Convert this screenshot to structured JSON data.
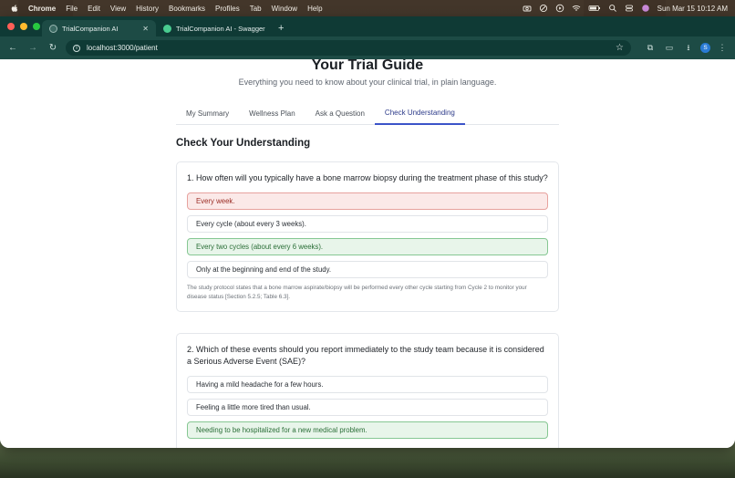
{
  "menubar": {
    "app": "Chrome",
    "menus": [
      "File",
      "Edit",
      "View",
      "History",
      "Bookmarks",
      "Profiles",
      "Tab",
      "Window",
      "Help"
    ],
    "clock": "Sun Mar 15  10:12 AM"
  },
  "browser": {
    "tabs": [
      {
        "title": "TrialCompanion AI",
        "active": true
      },
      {
        "title": "TrialCompanion AI - Swagger",
        "active": false
      }
    ],
    "url": "localhost:3000/patient",
    "profile_initial": "S"
  },
  "page": {
    "title": "Your Trial Guide",
    "subtitle": "Everything you need to know about your clinical trial, in plain language.",
    "tabs": [
      {
        "label": "My Summary",
        "active": false
      },
      {
        "label": "Wellness Plan",
        "active": false
      },
      {
        "label": "Ask a Question",
        "active": false
      },
      {
        "label": "Check Understanding",
        "active": true
      }
    ],
    "section_title": "Check Your Understanding",
    "questions": [
      {
        "text": "1. How often will you typically have a bone marrow biopsy during the treatment phase of this study?",
        "options": [
          {
            "label": "Every week.",
            "state": "wrong"
          },
          {
            "label": "Every cycle (about every 3 weeks).",
            "state": "neutral"
          },
          {
            "label": "Every two cycles (about every 6 weeks).",
            "state": "correct"
          },
          {
            "label": "Only at the beginning and end of the study.",
            "state": "neutral"
          }
        ],
        "explanation": "The study protocol states that a bone marrow aspirate/biopsy will be performed every other cycle starting from Cycle 2 to monitor your disease status [Section 5.2.5; Table 6.3]."
      },
      {
        "text": "2. Which of these events should you report immediately to the study team because it is considered a Serious Adverse Event (SAE)?",
        "options": [
          {
            "label": "Having a mild headache for a few hours.",
            "state": "neutral"
          },
          {
            "label": "Feeling a little more tired than usual.",
            "state": "neutral"
          },
          {
            "label": "Needing to be hospitalized for a new medical problem.",
            "state": "correct"
          }
        ]
      }
    ]
  },
  "colors": {
    "chrome_dark": "#0f3a35",
    "chrome_mid": "#1d4b45",
    "tab_active_accent": "#3c54c9",
    "wrong_bg": "#fbe9e8",
    "correct_bg": "#e8f5ea"
  }
}
